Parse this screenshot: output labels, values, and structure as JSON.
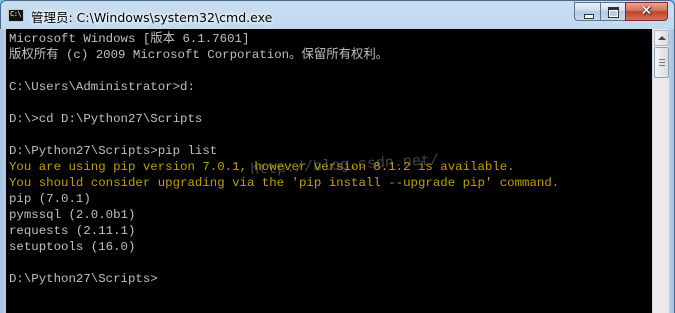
{
  "window": {
    "title": "管理员: C:\\Windows\\system32\\cmd.exe",
    "icon_label": "C:\\",
    "controls": {
      "minimize": "minimize",
      "maximize": "maximize",
      "close": "✕"
    }
  },
  "console": {
    "lines": [
      {
        "text": "Microsoft Windows [版本 6.1.7601]",
        "kind": "normal"
      },
      {
        "text": "版权所有 (c) 2009 Microsoft Corporation。保留所有权利。",
        "kind": "normal"
      },
      {
        "text": "",
        "kind": "normal"
      },
      {
        "text": "C:\\Users\\Administrator>d:",
        "kind": "normal"
      },
      {
        "text": "",
        "kind": "normal"
      },
      {
        "text": "D:\\>cd D:\\Python27\\Scripts",
        "kind": "normal"
      },
      {
        "text": "",
        "kind": "normal"
      },
      {
        "text": "D:\\Python27\\Scripts>pip list",
        "kind": "normal"
      },
      {
        "text": "You are using pip version 7.0.1, however version 8.1.2 is available.",
        "kind": "warn"
      },
      {
        "text": "You should consider upgrading via the 'pip install --upgrade pip' command.",
        "kind": "warn"
      },
      {
        "text": "pip (7.0.1)",
        "kind": "normal"
      },
      {
        "text": "pymssql (2.0.0b1)",
        "kind": "normal"
      },
      {
        "text": "requests (2.11.1)",
        "kind": "normal"
      },
      {
        "text": "setuptools (16.0)",
        "kind": "normal"
      },
      {
        "text": "",
        "kind": "normal"
      },
      {
        "text": "D:\\Python27\\Scripts>",
        "kind": "normal"
      }
    ],
    "watermark": "http://blog.csdn.net/"
  },
  "colors": {
    "console_bg": "#000000",
    "console_text": "#c0c0c0",
    "warning_text": "#c0a000"
  }
}
